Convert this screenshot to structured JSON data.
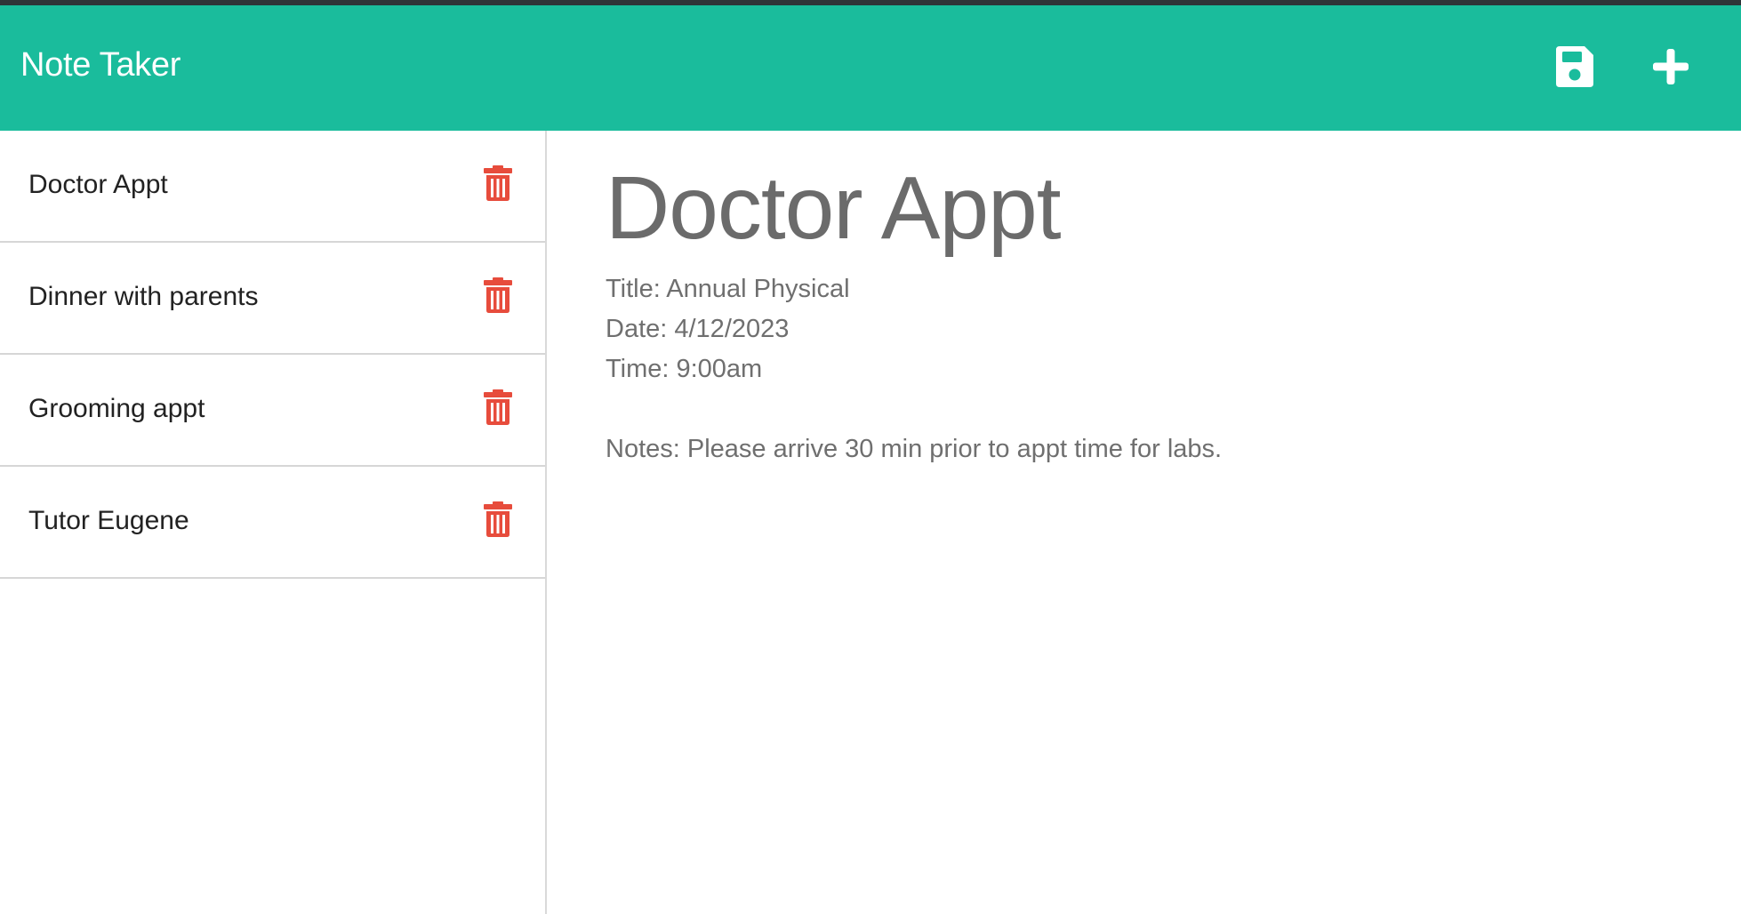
{
  "app": {
    "title": "Note Taker"
  },
  "toolbar": {
    "save_icon": "floppy-disk-icon",
    "new_icon": "plus-icon"
  },
  "colors": {
    "navbar": "#1abc9c",
    "delete_icon": "#e74c3c",
    "heading_text": "#6b6b6b"
  },
  "sidebar": {
    "items": [
      {
        "label": "Doctor Appt",
        "icon": "trash-icon"
      },
      {
        "label": "Dinner with parents",
        "icon": "trash-icon"
      },
      {
        "label": "Grooming appt",
        "icon": "trash-icon"
      },
      {
        "label": "Tutor Eugene",
        "icon": "trash-icon"
      }
    ]
  },
  "note": {
    "heading": "Doctor Appt",
    "lines": [
      "Title: Annual Physical",
      "Date: 4/12/2023",
      "Time: 9:00am",
      "",
      "Notes: Please arrive 30 min prior to appt time for labs."
    ]
  }
}
